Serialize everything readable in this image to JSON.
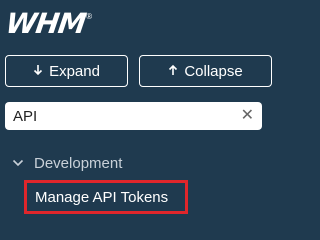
{
  "brand": {
    "logo_text": "WHM",
    "registered_mark": "®"
  },
  "toolbar": {
    "expand_label": "Expand",
    "collapse_label": "Collapse",
    "expand_icon": "arrow-down-icon",
    "collapse_icon": "arrow-up-icon"
  },
  "search": {
    "value": "API",
    "placeholder": "",
    "clear_glyph": "✕"
  },
  "nav": {
    "section_label": "Development",
    "section_expanded": true,
    "items": [
      {
        "label": "Manage API Tokens",
        "highlighted": true
      }
    ]
  },
  "colors": {
    "background": "#1f3a4f",
    "text": "#ffffff",
    "highlight_border": "#e0262b"
  }
}
